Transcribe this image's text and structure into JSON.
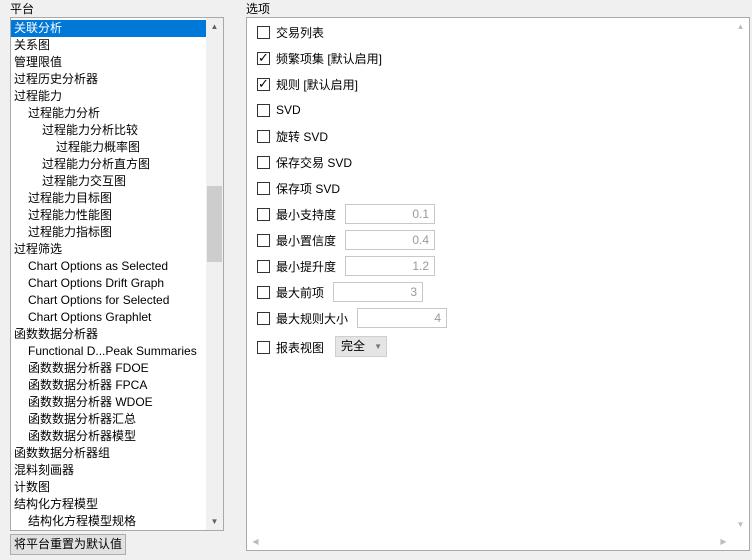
{
  "left_label": "平台",
  "right_label": "选项",
  "platforms": [
    {
      "label": "关联分析",
      "level": 0,
      "selected": true
    },
    {
      "label": "关系图",
      "level": 0
    },
    {
      "label": "管理限值",
      "level": 0
    },
    {
      "label": "过程历史分析器",
      "level": 0
    },
    {
      "label": "过程能力",
      "level": 0
    },
    {
      "label": "过程能力分析",
      "level": 1
    },
    {
      "label": "过程能力分析比较",
      "level": 2
    },
    {
      "label": "过程能力概率图",
      "level": 3
    },
    {
      "label": "过程能力分析直方图",
      "level": 2
    },
    {
      "label": "过程能力交互图",
      "level": 2
    },
    {
      "label": "过程能力目标图",
      "level": 1
    },
    {
      "label": "过程能力性能图",
      "level": 1
    },
    {
      "label": "过程能力指标图",
      "level": 1
    },
    {
      "label": "过程筛选",
      "level": 0
    },
    {
      "label": "Chart Options as Selected",
      "level": 1
    },
    {
      "label": "Chart Options Drift Graph",
      "level": 1
    },
    {
      "label": "Chart Options for Selected",
      "level": 1
    },
    {
      "label": "Chart Options Graphlet",
      "level": 1
    },
    {
      "label": "函数数据分析器",
      "level": 0
    },
    {
      "label": "Functional D...Peak Summaries",
      "level": 1
    },
    {
      "label": "函数数据分析器 FDOE",
      "level": 1
    },
    {
      "label": "函数数据分析器 FPCA",
      "level": 1
    },
    {
      "label": "函数数据分析器 WDOE",
      "level": 1
    },
    {
      "label": "函数数据分析器汇总",
      "level": 1
    },
    {
      "label": "函数数据分析器模型",
      "level": 1
    },
    {
      "label": "函数数据分析器组",
      "level": 0
    },
    {
      "label": "混料刻画器",
      "level": 0
    },
    {
      "label": "计数图",
      "level": 0
    },
    {
      "label": "结构化方程模型",
      "level": 0
    },
    {
      "label": "结构化方程模型规格",
      "level": 1
    }
  ],
  "reset_button": "将平台重置为默认值",
  "options": [
    {
      "label": "交易列表",
      "checked": false
    },
    {
      "label": "频繁项集 [默认启用]",
      "checked": true
    },
    {
      "label": "规则 [默认启用]",
      "checked": true
    },
    {
      "label": "SVD",
      "checked": false
    },
    {
      "label": "旋转 SVD",
      "checked": false
    },
    {
      "label": "保存交易 SVD",
      "checked": false
    },
    {
      "label": "保存项 SVD",
      "checked": false
    },
    {
      "label": "最小支持度",
      "checked": false,
      "value": "0.1"
    },
    {
      "label": "最小置信度",
      "checked": false,
      "value": "0.4"
    },
    {
      "label": "最小提升度",
      "checked": false,
      "value": "1.2"
    },
    {
      "label": "最大前项",
      "checked": false,
      "value": "3"
    },
    {
      "label": "最大规则大小",
      "checked": false,
      "value": "4"
    },
    {
      "label": "报表视图",
      "checked": false,
      "select": "完全"
    }
  ],
  "icons": {
    "check": "checkmark-icon",
    "up": "scroll-up-icon",
    "down": "scroll-down-icon",
    "caret": "chevron-down-icon"
  },
  "colors": {
    "selection": "#0078d7"
  }
}
